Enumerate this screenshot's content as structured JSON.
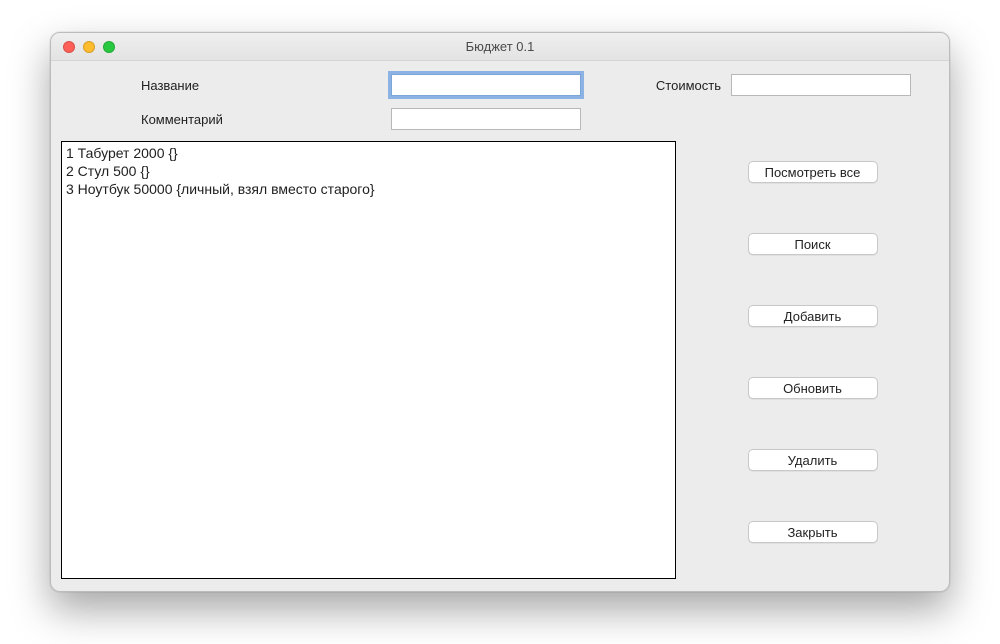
{
  "window": {
    "title": "Бюджет 0.1"
  },
  "form": {
    "name_label": "Название",
    "name_value": "",
    "cost_label": "Стоимость",
    "cost_value": "",
    "comment_label": "Комментарий",
    "comment_value": ""
  },
  "list": {
    "items": [
      "1 Табурет 2000 {}",
      "2 Стул 500 {}",
      "3 Ноутбук 50000 {личный, взял вместо старого}"
    ]
  },
  "buttons": {
    "view_all": "Посмотреть все",
    "search": "Поиск",
    "add": "Добавить",
    "update": "Обновить",
    "delete": "Удалить",
    "close": "Закрыть"
  }
}
